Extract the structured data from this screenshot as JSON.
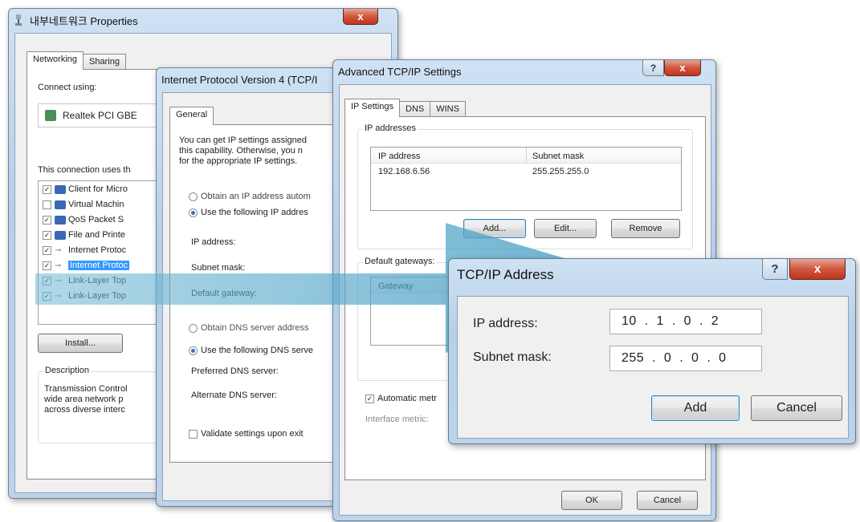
{
  "win1": {
    "title": "내부네트워크 Properties",
    "tabs": [
      "Networking",
      "Sharing"
    ],
    "connect_using": "Connect using:",
    "adapter": "Realtek PCI GBE",
    "uses_label": "This connection uses th",
    "items": [
      {
        "label": "Client for Micro",
        "checked": true,
        "icon": "computer-icon"
      },
      {
        "label": "Virtual Machin",
        "checked": false,
        "icon": "computer-icon"
      },
      {
        "label": "QoS Packet S",
        "checked": true,
        "icon": "computer-icon"
      },
      {
        "label": "File and Printe",
        "checked": true,
        "icon": "computer-icon"
      },
      {
        "label": "Internet Protoc",
        "checked": true,
        "icon": "protocol-icon"
      },
      {
        "label": "Internet Protoc",
        "checked": true,
        "icon": "protocol-icon",
        "selected": true
      },
      {
        "label": "Link-Layer Top",
        "checked": true,
        "icon": "protocol-icon"
      },
      {
        "label": "Link-Layer Top",
        "checked": true,
        "icon": "protocol-icon"
      }
    ],
    "install_btn": "Install...",
    "description_title": "Description",
    "description_lines": [
      "Transmission Control",
      "wide area network p",
      "across diverse interc"
    ],
    "close": "x"
  },
  "win2": {
    "title": "Internet Protocol Version 4 (TCP/I",
    "tab": "General",
    "intro_lines": [
      "You can get IP settings assigned",
      "this capability. Otherwise, you n",
      "for the appropriate IP settings."
    ],
    "obtain_ip": "Obtain an IP address autom",
    "use_ip": "Use the following IP addres",
    "ip_address": "IP address:",
    "subnet_mask": "Subnet mask:",
    "default_gateway": "Default gateway:",
    "obtain_dns": "Obtain DNS server address",
    "use_dns": "Use the following DNS serve",
    "preferred_dns": "Preferred DNS server:",
    "alternate_dns": "Alternate DNS server:",
    "validate": "Validate settings upon exit"
  },
  "win3": {
    "title": "Advanced TCP/IP Settings",
    "tabs": [
      "IP Settings",
      "DNS",
      "WINS"
    ],
    "ip_addresses_group": "IP addresses",
    "col_ip": "IP address",
    "col_subnet": "Subnet mask",
    "row_ip": "192.168.6.56",
    "row_subnet": "255.255.255.0",
    "add": "Add...",
    "edit": "Edit...",
    "remove": "Remove",
    "gateways_group": "Default gateways:",
    "col_gateway": "Gateway",
    "auto_metric": "Automatic metr",
    "interface_metric": "Interface metric:",
    "ok": "OK",
    "cancel": "Cancel",
    "help": "?",
    "close": "x"
  },
  "win4": {
    "title": "TCP/IP Address",
    "ip_label": "IP address:",
    "subnet_label": "Subnet mask:",
    "ip_value": "10  .  1  .  0  .  2",
    "subnet_value": "255  .  0  .  0  .  0",
    "add": "Add",
    "cancel": "Cancel",
    "help": "?",
    "close": "x"
  },
  "colors": {
    "highlight": "#3399ff",
    "arrow": "#4fa3c7"
  }
}
